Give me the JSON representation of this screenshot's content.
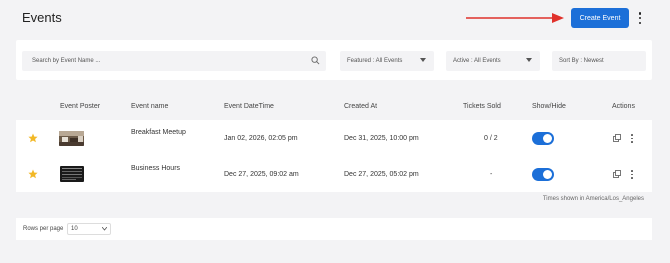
{
  "header": {
    "title": "Events",
    "create_label": "Create Event"
  },
  "filters": {
    "search_placeholder": "Search by Event Name ...",
    "featured": "Featured : All Events",
    "active": "Active : All Events",
    "sort": "Sort By : Newest"
  },
  "table": {
    "columns": [
      "",
      "Event Poster",
      "Event name",
      "Event DateTime",
      "Created At",
      "Tickets Sold",
      "Show/Hide",
      "Actions"
    ],
    "rows": [
      {
        "featured": true,
        "name": "Breakfast Meetup",
        "datetime": "Jan 02, 2026, 02:05 pm",
        "created": "Dec 31, 2025, 10:00 pm",
        "tickets": "0 / 2",
        "visible": true
      },
      {
        "featured": true,
        "name": "Business Hours",
        "datetime": "Dec 27, 2025, 09:02 am",
        "created": "Dec 27, 2025, 05:02 pm",
        "tickets": "-",
        "visible": true
      }
    ],
    "timezone_note": "Times shown in America/Los_Angeles"
  },
  "pagination": {
    "rows_per_page_label": "Rows per page",
    "rows_per_page_value": "10"
  },
  "colors": {
    "accent": "#1c6fd8",
    "star": "#f2b826",
    "arrow": "#e0312b"
  },
  "icons": [
    "search-icon",
    "chevron-down-icon",
    "star-icon",
    "copy-icon",
    "more-vertical-icon",
    "arrow-right-icon"
  ]
}
